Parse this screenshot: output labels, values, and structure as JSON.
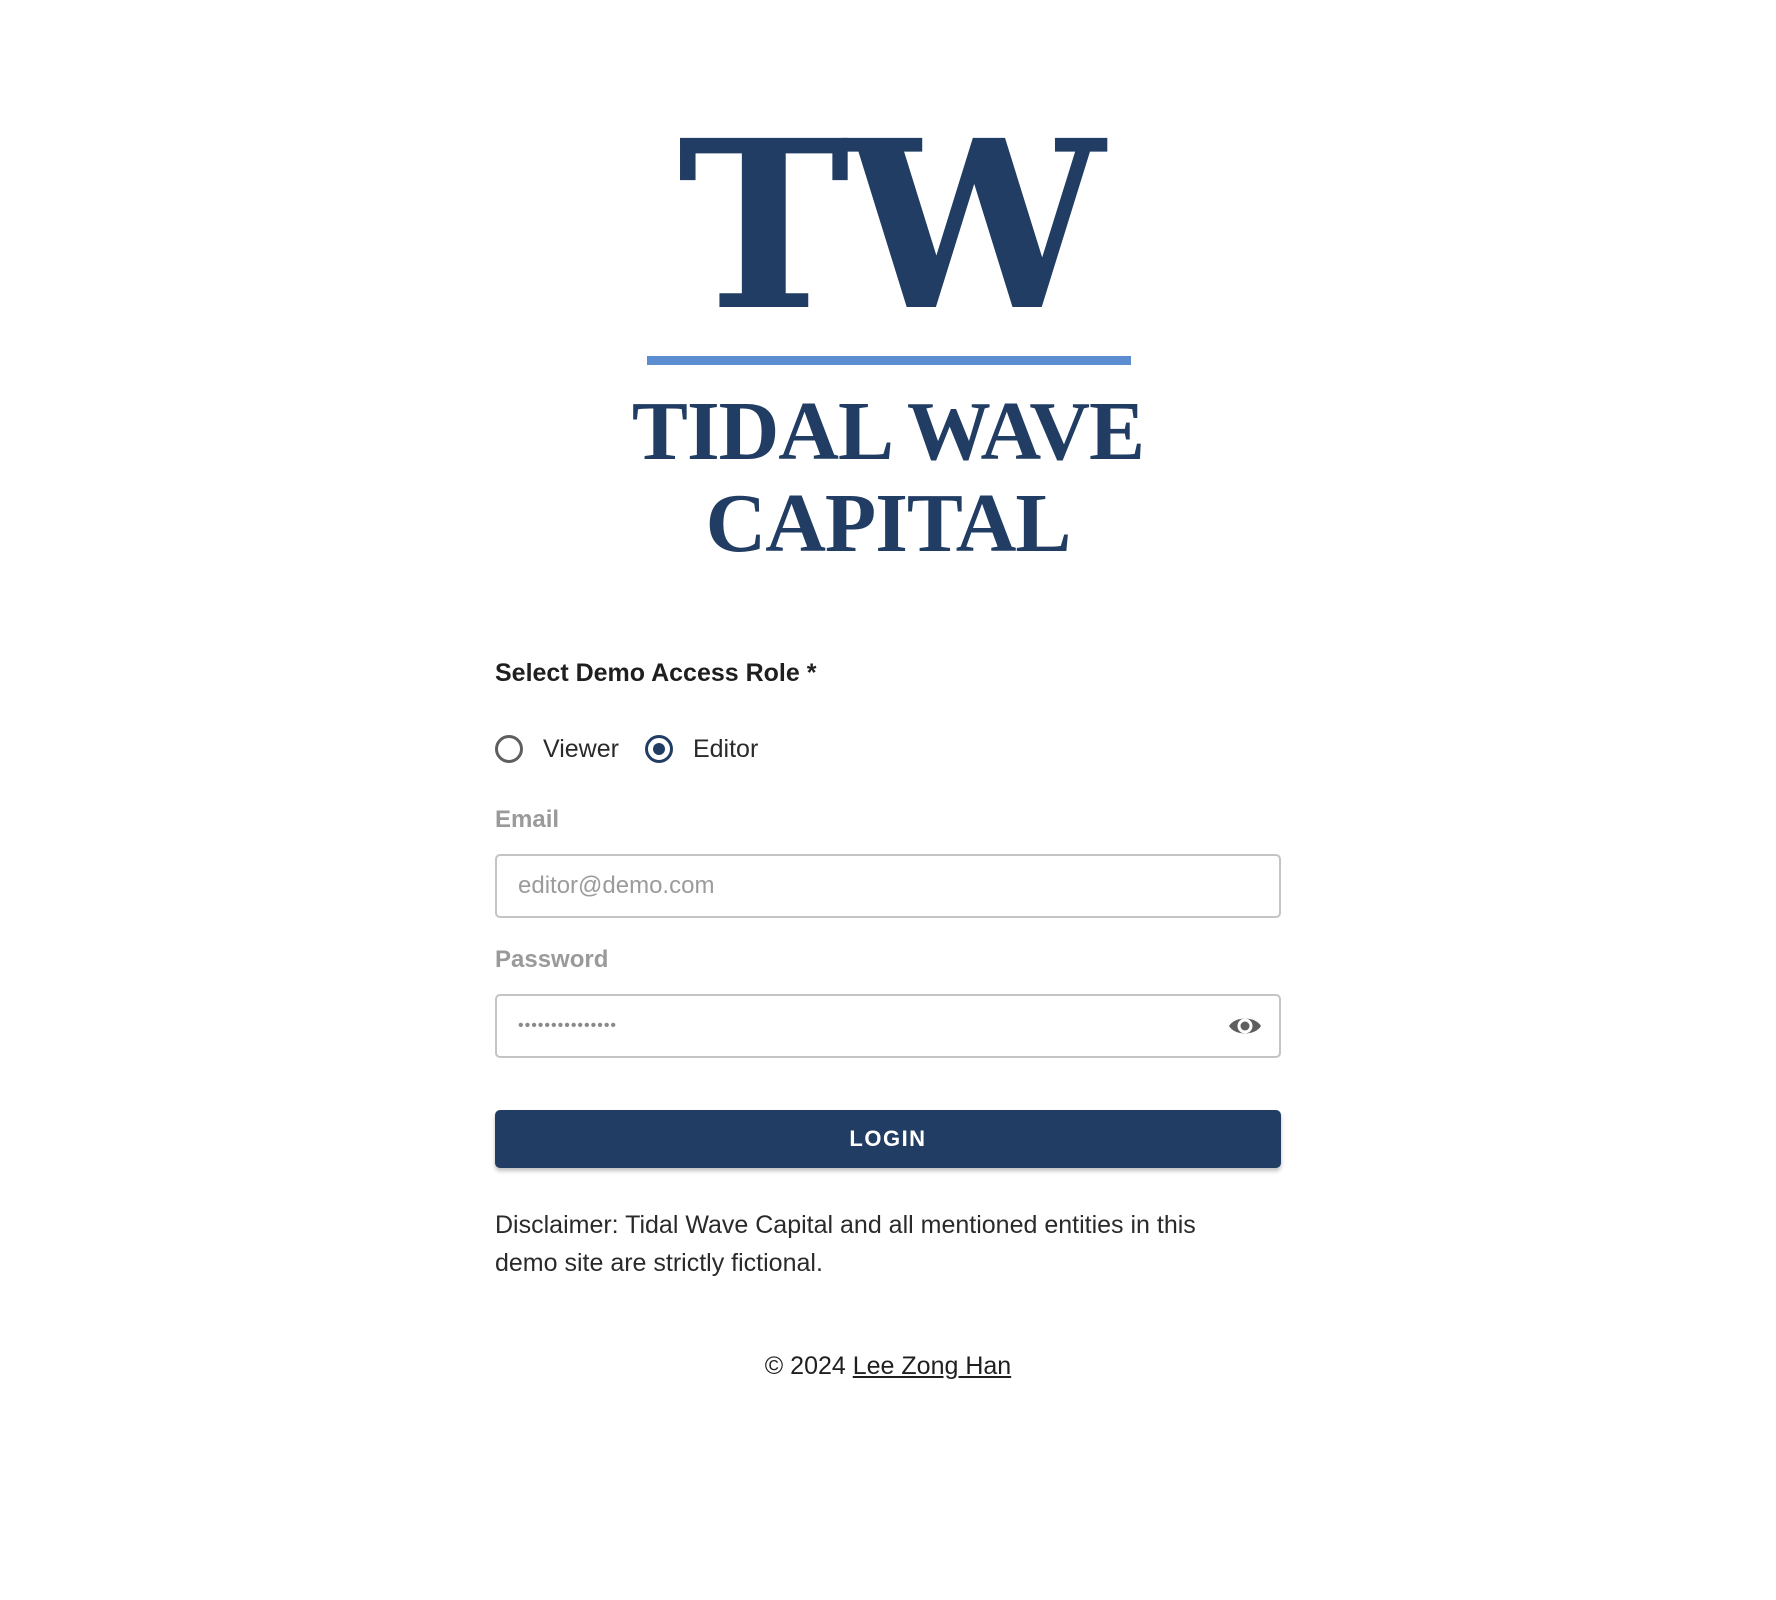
{
  "logo": {
    "monogram": "TW",
    "name_line1": "TIDAL WAVE",
    "name_line2": "CAPITAL",
    "primary_color": "#223d63",
    "rule_color": "#5b8dd0"
  },
  "form": {
    "role_label": "Select Demo Access Role *",
    "roles": [
      {
        "label": "Viewer",
        "checked": false
      },
      {
        "label": "Editor",
        "checked": true
      }
    ],
    "email_label": "Email",
    "email_placeholder": "editor@demo.com",
    "password_label": "Password",
    "password_mask": "•••••••••••••••",
    "login_label": "LOGIN"
  },
  "disclaimer": "Disclaimer: Tidal Wave Capital and all mentioned entities in this demo site are strictly fictional.",
  "footer": {
    "copyright": "© 2024",
    "author_link": "Lee Zong Han"
  }
}
